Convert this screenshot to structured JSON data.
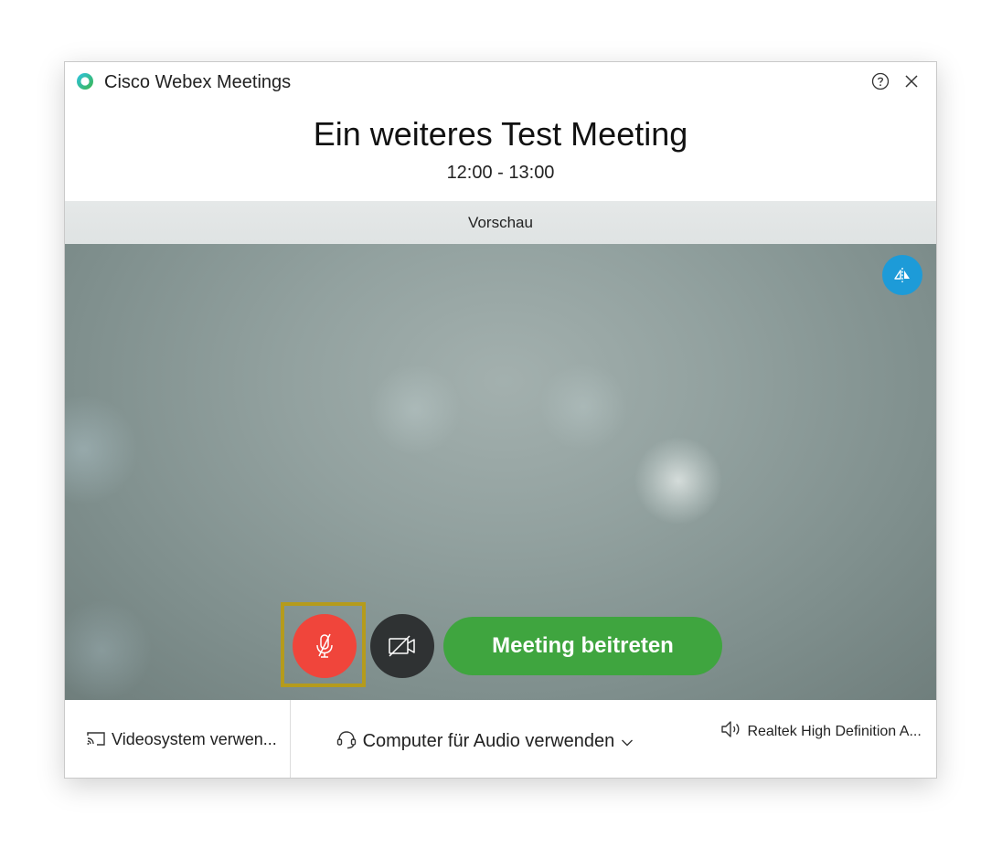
{
  "window": {
    "app_title": "Cisco Webex Meetings",
    "icons": {
      "logo": "webex-logo-icon",
      "help": "help-icon",
      "close": "close-icon"
    }
  },
  "meeting": {
    "title": "Ein weiteres Test Meeting",
    "time": "12:00 - 13:00"
  },
  "preview": {
    "label": "Vorschau"
  },
  "controls": {
    "mirror_icon": "mirror-view-icon",
    "mute_icon": "microphone-muted-icon",
    "video_icon": "camera-off-icon",
    "join_label": "Meeting beitreten",
    "colors": {
      "mute": "#f0453b",
      "video": "#2f3233",
      "join": "#3fa53f",
      "mirror": "#1d9bd8",
      "highlight": "#b59b1c"
    }
  },
  "footer": {
    "video_system_label": "Videosystem verwen...",
    "audio_label": "Computer für Audio verwenden",
    "speaker_label": "Realtek High Definition A..."
  }
}
